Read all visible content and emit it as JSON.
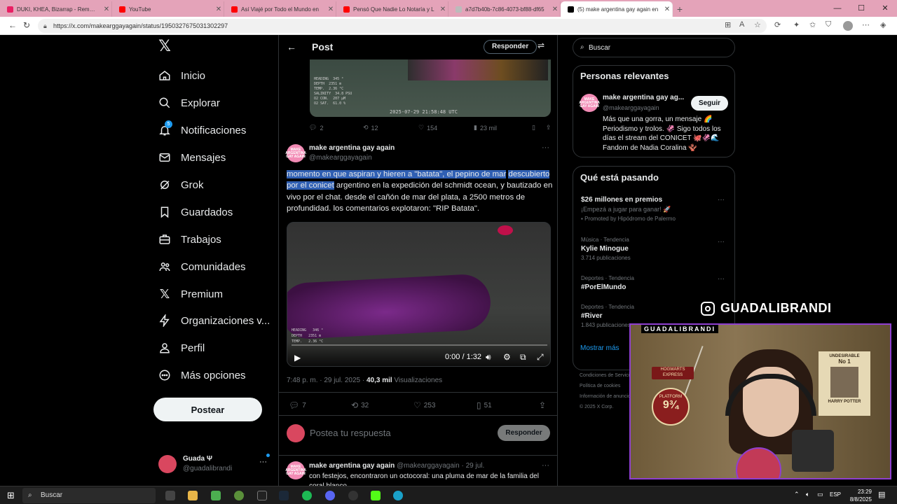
{
  "browser": {
    "tabs": [
      {
        "title": "DUKI, KHEA, Bizarrap - Rememb",
        "color": "#e91e63"
      },
      {
        "title": "YouTube",
        "color": "#ff0000"
      },
      {
        "title": "Así Viajé por Todo el Mundo en",
        "color": "#ff0000"
      },
      {
        "title": "Pensó Que Nadie Lo Notaría y L",
        "color": "#ff0000"
      },
      {
        "title": "a7d7b40b-7c86-4073-bf88-df65",
        "color": "#999999"
      },
      {
        "title": "(5) make argentina gay again en",
        "color": "#000000"
      }
    ],
    "url": "https://x.com/makearggayagain/status/1950327675031302297"
  },
  "nav": {
    "items": [
      "Inicio",
      "Explorar",
      "Notificaciones",
      "Mensajes",
      "Grok",
      "Guardados",
      "Trabajos",
      "Comunidades",
      "Premium",
      "Organizaciones v...",
      "Perfil",
      "Más opciones"
    ],
    "notif_badge": "5",
    "post_button": "Postear",
    "account_name": "Guada Ψ",
    "account_handle": "@guadalibrandi"
  },
  "header": {
    "title": "Post",
    "reply_button": "Responder"
  },
  "prev_tweet": {
    "overlay": {
      "heading": "HEADING",
      "heading_val": "345 °",
      "depth": "DEPTH",
      "depth_val": "2351 m",
      "temp": "TEMP.",
      "temp_val": "2.36 °C",
      "salinity": "SALINITY",
      "salinity_val": "34.8 PSU",
      "o2": "O2 CON.",
      "o2_val": "207 µM",
      "o2sat": "O2 SAT.",
      "o2sat_val": "61.0 %",
      "stamp": "2025-07-29  21:58:48 UTC"
    },
    "replies": "2",
    "reposts": "12",
    "likes": "154",
    "views": "23 mil"
  },
  "main_tweet": {
    "avatar_text": "MAKE ARGENTINA GAY AGAIN",
    "name": "make argentina gay again",
    "handle": "@makearggayagain",
    "text_sel1": "momento en que aspiran y hieren a \"batata\", el pepino de mar",
    "text_sel2": "descubierto por el conicet",
    "text_rest": " argentino en la expedición del schmidt ocean, y bautizado en vivo por el chat. desde el cañón de mar del plata, a 2500 metros de profundidad. los comentarios explotaron: \"RIP Batata\".",
    "video": {
      "heading": "HEADING",
      "heading_val": "346 °",
      "depth": "DEPTH",
      "depth_val": "2351 m",
      "temp": "TEMP.",
      "temp_val": "2.36 °C",
      "time": "0:00 / 1:32",
      "progress": 0
    },
    "time": "7:48 p. m. · 29 jul. 2025 · ",
    "views": "40,3 mil",
    "views_label": " Visualizaciones",
    "replies": "7",
    "reposts": "32",
    "likes": "253",
    "bookmarks": "51"
  },
  "reply_box": {
    "placeholder": "Postea tu respuesta",
    "button": "Responder"
  },
  "next_tweet": {
    "avatar_text": "MAKE ARGENTINA GAY AGAIN",
    "name": "make argentina gay again",
    "meta": "@makearggayagain · 29 jul.",
    "text": "con festejos, encontraron un octocoral: una pluma de mar de la familia del coral blanco"
  },
  "search": {
    "placeholder": "Buscar"
  },
  "relevant": {
    "title": "Personas relevantes",
    "avatar_text": "MAKE ARGENTINA GAY AGAIN",
    "name": "make argentina gay ag...",
    "handle": "@makearggayagain",
    "follow": "Seguir",
    "bio": "Más que una gorra, un mensaje 🌈 Periodismo y trolos. 🦑 Sigo todos los días el stream del CONICET 🐙🦑🌊 Fandom de Nadia Coralina 🪸"
  },
  "trends": {
    "title": "Qué está pasando",
    "items": [
      {
        "cat": "",
        "name": "$26 millones en premios",
        "cnt": "¡Empezá a jugar para ganar! 🚀",
        "promo": "Promoted by Hipódromo de Palermo"
      },
      {
        "cat": "Música · Tendencia",
        "name": "Kylie Minogue",
        "cnt": "3.714 publicaciones"
      },
      {
        "cat": "Deportes · Tendencia",
        "name": "#PorElMundo",
        "cnt": ""
      },
      {
        "cat": "Deportes · Tendencia",
        "name": "#River",
        "cnt": "1.843 publicaciones"
      }
    ],
    "show_more": "Mostrar más"
  },
  "footer": {
    "l1": "Condiciones de Servicio",
    "l2": "Política de cookies",
    "l3": "Información de anuncios",
    "l4": "© 2025 X Corp."
  },
  "stream": {
    "ig_handle": "GUADALIBRANDI",
    "cam_label": "GUADALIBRANDI",
    "sign1": "UNDESIRABLE",
    "sign2": "No 1",
    "sign3": "HARRY POTTER",
    "platform": "PLATFORM",
    "platform_num": "9¾",
    "hogwarts": "HOGWARTS EXPRESS"
  },
  "taskbar": {
    "search": "Buscar",
    "lang": "ESP",
    "time": "23:29",
    "date": "8/8/2025"
  }
}
